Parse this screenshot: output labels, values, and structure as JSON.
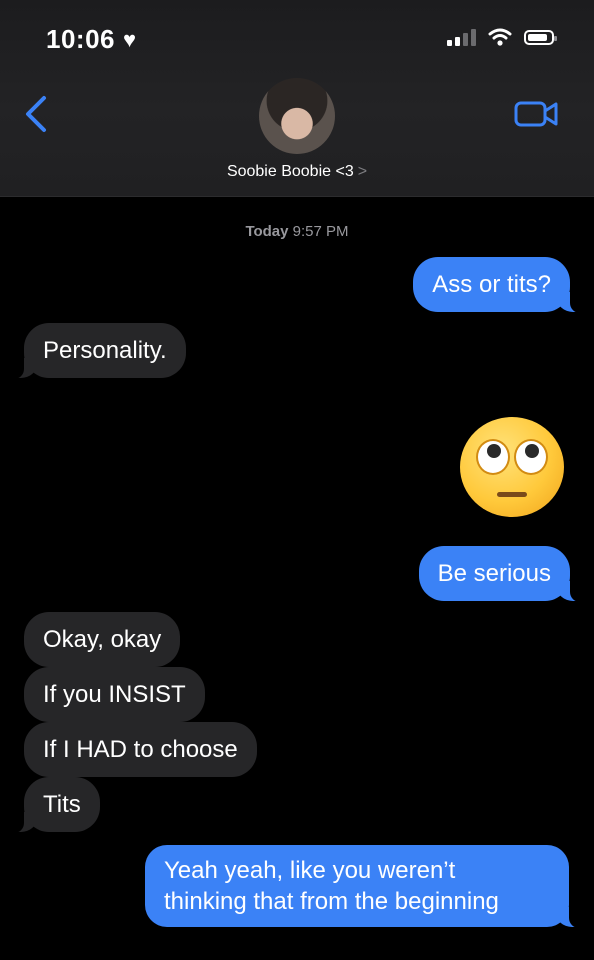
{
  "status_bar": {
    "time": "10:06",
    "heart": "♥",
    "battery_icon": "battery-icon",
    "wifi_icon": "wifi-icon"
  },
  "header": {
    "contact_name": "Soobie Boobie <3",
    "chevron": ">",
    "back_icon": "chevron-left-icon",
    "video_icon": "video-camera-icon",
    "accent": "#3b82f6"
  },
  "thread": {
    "timestamp_day": "Today",
    "timestamp_time": "9:57 PM",
    "messages": [
      {
        "dir": "out",
        "text": "Ass or tits?"
      },
      {
        "dir": "in",
        "text": "Personality."
      },
      {
        "dir": "out",
        "text": "🙄",
        "emoji_name": "face-with-rolling-eyes"
      },
      {
        "dir": "out",
        "text": "Be serious"
      },
      {
        "dir": "in",
        "text": "Okay, okay"
      },
      {
        "dir": "in",
        "text": "If you INSIST"
      },
      {
        "dir": "in",
        "text": "If I HAD to choose"
      },
      {
        "dir": "in",
        "text": "Tits"
      },
      {
        "dir": "out",
        "text_line1": "Yeah yeah, like you weren’t",
        "text_line2": "thinking that from the beginning"
      }
    ]
  },
  "colors": {
    "outgoing": "#3b82f6",
    "incoming": "#262628",
    "background": "#000000"
  }
}
